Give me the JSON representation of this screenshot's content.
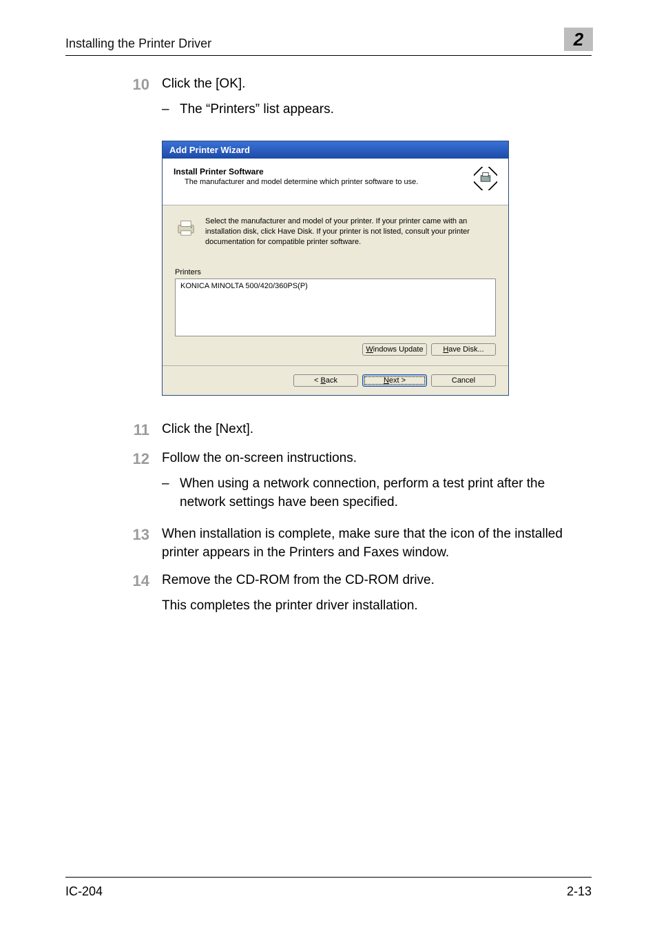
{
  "header": {
    "title": "Installing the Printer Driver",
    "chapter": "2"
  },
  "steps": {
    "s10": {
      "num": "10",
      "text": "Click the [OK].",
      "bullet": "The “Printers” list appears."
    },
    "s11": {
      "num": "11",
      "text": "Click the [Next]."
    },
    "s12": {
      "num": "12",
      "text": "Follow the on-screen instructions.",
      "bullet": "When using a network connection, perform a test print after the network settings have been specified."
    },
    "s13": {
      "num": "13",
      "text": "When installation is complete, make sure that the icon of the installed printer appears in the Printers and Faxes window."
    },
    "s14": {
      "num": "14",
      "text": "Remove the CD-ROM from the CD-ROM drive.",
      "after": "This completes the printer driver installation."
    }
  },
  "dialog": {
    "title": "Add Printer Wizard",
    "banner_head": "Install Printer Software",
    "banner_sub": "The manufacturer and model determine which printer software to use.",
    "instruction": "Select the manufacturer and model of your printer. If your printer came with an installation disk, click Have Disk. If your printer is not listed, consult your printer documentation for compatible printer software.",
    "list_label": "Printers",
    "printers": [
      "KONICA MINOLTA 500/420/360PS(P)"
    ],
    "buttons": {
      "windows_update": {
        "prefix": "W",
        "rest": "indows Update"
      },
      "have_disk": {
        "prefix": "H",
        "rest": "ave Disk..."
      },
      "back": {
        "pre": "< ",
        "ul": "B",
        "rest": "ack"
      },
      "next": {
        "ul": "N",
        "rest": "ext >"
      },
      "cancel": "Cancel"
    }
  },
  "footer": {
    "left": "IC-204",
    "right": "2-13"
  }
}
